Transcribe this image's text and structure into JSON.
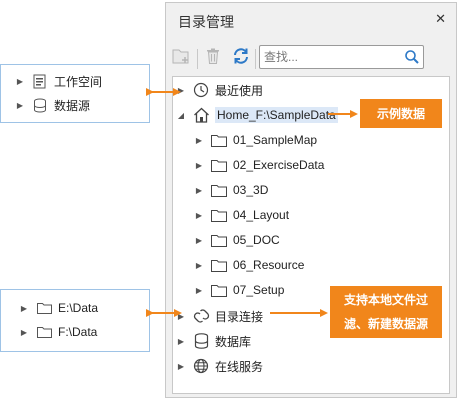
{
  "panel": {
    "title": "目录管理",
    "close_glyph": "✕",
    "toolbar": {
      "new_folder_icon": "new-folder-icon",
      "delete_icon": "delete-icon",
      "refresh_icon": "refresh-icon",
      "search_placeholder": "查找..."
    },
    "tree": [
      {
        "label": "最近使用",
        "icon": "clock-icon",
        "expander": "▶"
      },
      {
        "label": "Home_F:\\SampleData",
        "icon": "home-icon",
        "expander": "◢"
      },
      {
        "label": "01_SampleMap",
        "icon": "folder-icon",
        "expander": "▶"
      },
      {
        "label": "02_ExerciseData",
        "icon": "folder-icon",
        "expander": "▶"
      },
      {
        "label": "03_3D",
        "icon": "folder-icon",
        "expander": "▶"
      },
      {
        "label": "04_Layout",
        "icon": "folder-icon",
        "expander": "▶"
      },
      {
        "label": "05_DOC",
        "icon": "folder-icon",
        "expander": "▶"
      },
      {
        "label": "06_Resource",
        "icon": "folder-icon",
        "expander": "▶"
      },
      {
        "label": "07_Setup",
        "icon": "folder-icon",
        "expander": "▶"
      },
      {
        "label": "目录连接",
        "icon": "link-icon",
        "expander": "▶"
      },
      {
        "label": "数据库",
        "icon": "database-icon",
        "expander": "▶"
      },
      {
        "label": "在线服务",
        "icon": "globe-icon",
        "expander": "▶"
      }
    ]
  },
  "left_top_box": {
    "items": [
      {
        "label": "工作空间",
        "icon": "workspace-icon"
      },
      {
        "label": "数据源",
        "icon": "datasource-icon"
      }
    ]
  },
  "left_bottom_box": {
    "items": [
      {
        "label": "E:\\Data",
        "icon": "folder-icon"
      },
      {
        "label": "F:\\Data",
        "icon": "folder-icon"
      }
    ]
  },
  "callouts": {
    "example_data": "示例数据",
    "filter_new": "支持本地文件过滤、新建数据源"
  },
  "colors": {
    "accent_orange": "#f1861b",
    "sidebox_border": "#9ec3e6",
    "selection": "#dce8f7"
  }
}
